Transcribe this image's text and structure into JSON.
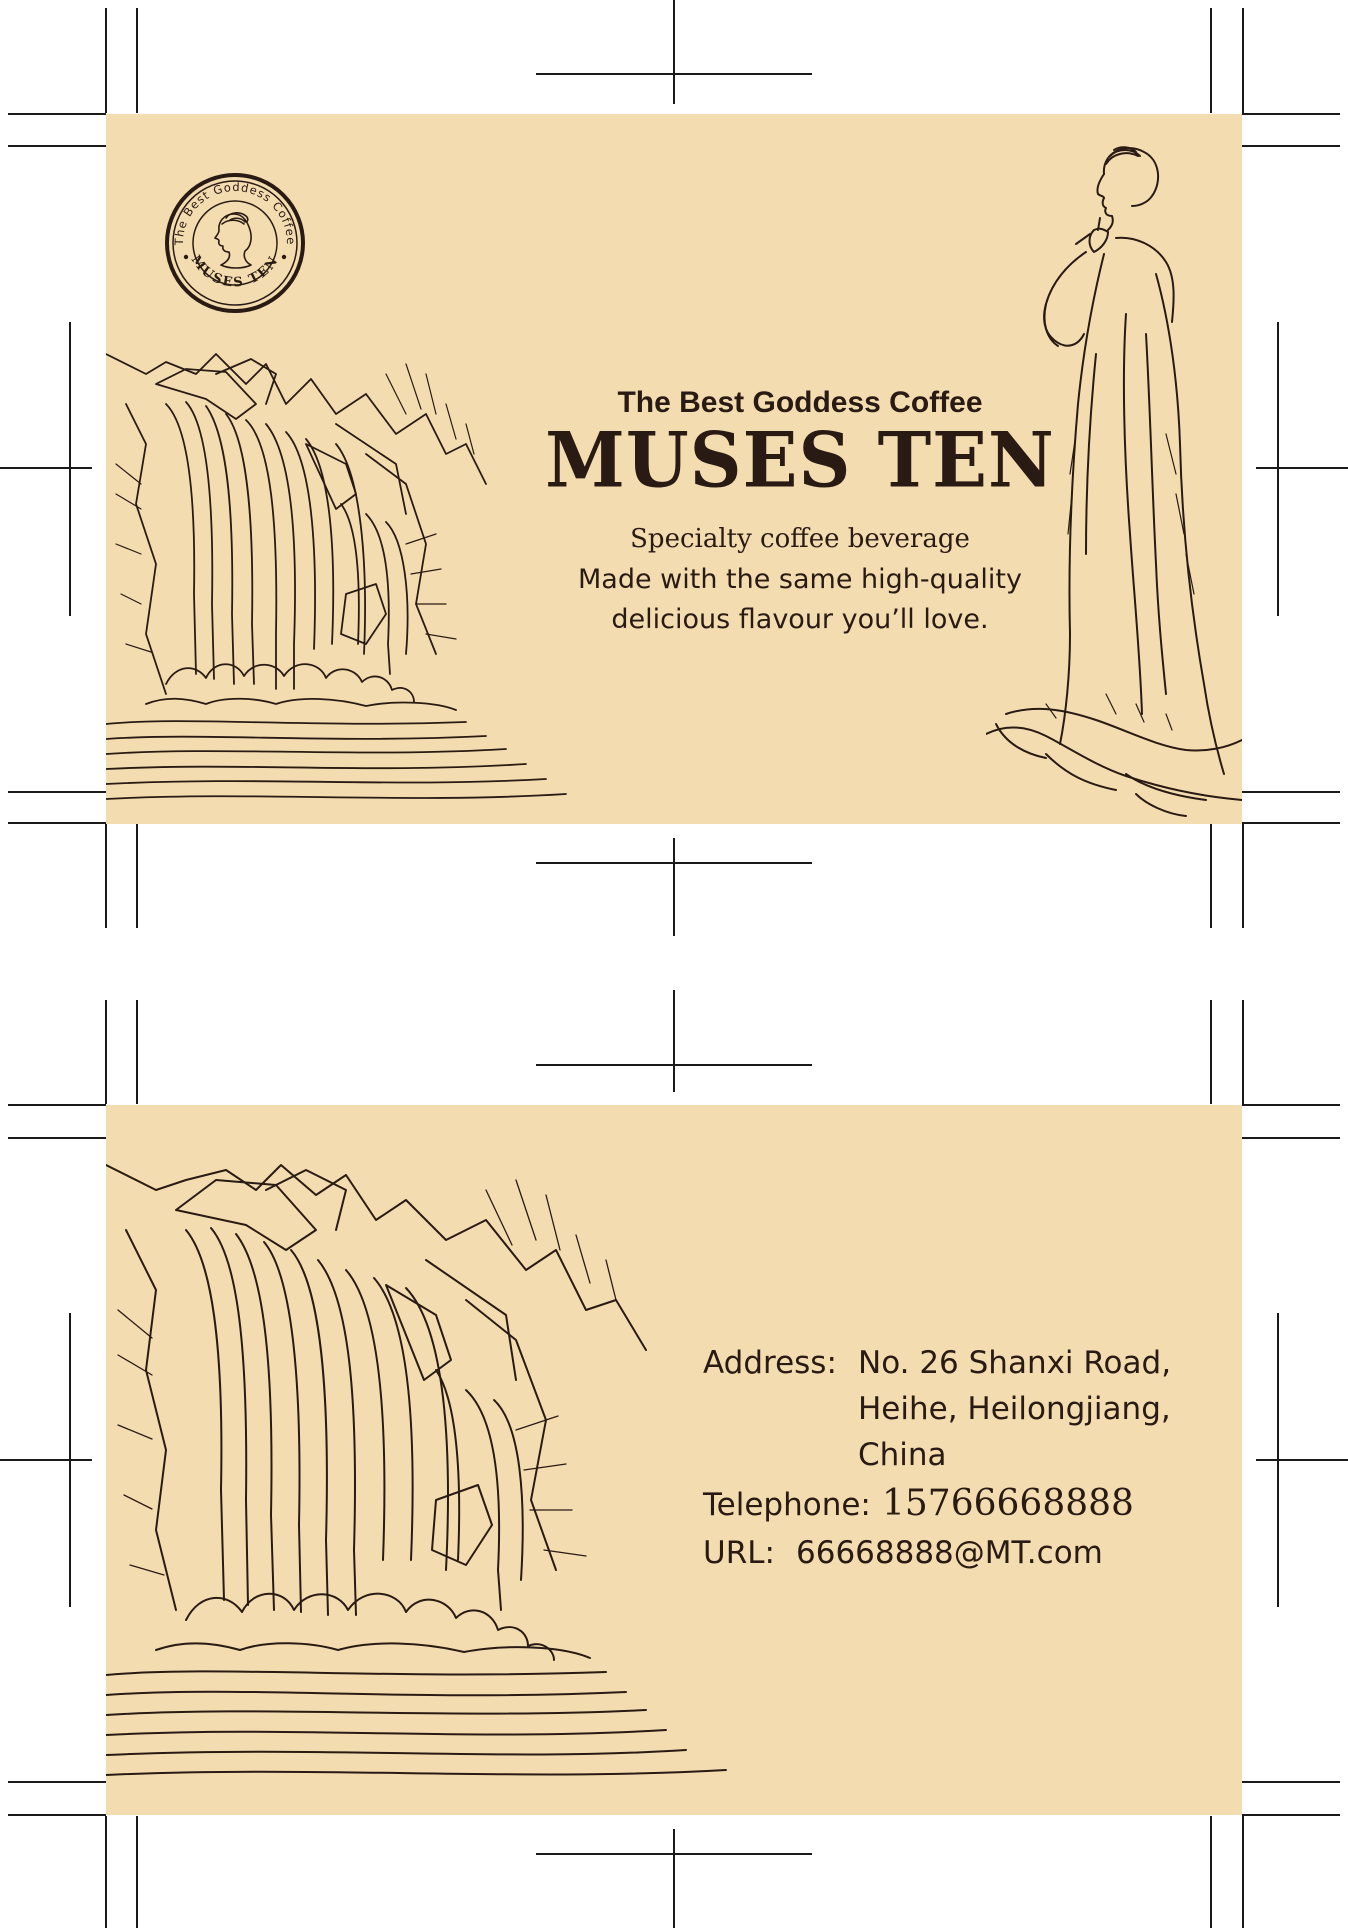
{
  "front": {
    "seal": {
      "ring_text": "The Best Goddess Coffee",
      "bottom_text": "MUSES TEN"
    },
    "tagline": "The Best Goddess Coffee",
    "brand": "MUSES TEN",
    "copy": {
      "line1": "Specialty coffee beverage",
      "line2": "Made with the same high-quality",
      "line3": "delicious flavour you’ll love."
    }
  },
  "back": {
    "address_label": "Address:",
    "address_lines": [
      "No. 26 Shanxi Road,",
      "Heihe, Heilongjiang,",
      "China"
    ],
    "telephone_label": "Telephone:",
    "telephone": "15766668888",
    "url_label": "URL:",
    "url": "66668888@MT.com"
  },
  "colors": {
    "card_background": "#f3ddb0",
    "ink": "#2a1a14",
    "crop_marks": "#1a1a1a"
  },
  "icons": [
    "waterfall-illustration",
    "goddess-illustration",
    "seal-logo"
  ]
}
